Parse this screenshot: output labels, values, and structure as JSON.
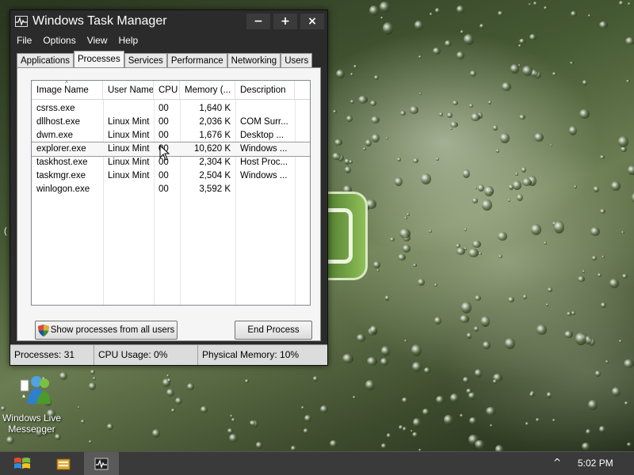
{
  "window": {
    "title": "Windows Task Manager",
    "controls": {
      "minimize": "−",
      "maximize": "+",
      "close": "×"
    }
  },
  "menu": [
    "File",
    "Options",
    "View",
    "Help"
  ],
  "tabs": [
    "Applications",
    "Processes",
    "Services",
    "Performance",
    "Networking",
    "Users"
  ],
  "active_tab": "Processes",
  "columns": [
    "Image Name",
    "User Name",
    "CPU",
    "Memory (...",
    "Description"
  ],
  "processes": [
    {
      "image": "csrss.exe",
      "user": "",
      "cpu": "00",
      "memory": "1,640 K",
      "desc": ""
    },
    {
      "image": "dllhost.exe",
      "user": "Linux Mint",
      "cpu": "00",
      "memory": "2,036 K",
      "desc": "COM Surr..."
    },
    {
      "image": "dwm.exe",
      "user": "Linux Mint",
      "cpu": "00",
      "memory": "1,676 K",
      "desc": "Desktop ..."
    },
    {
      "image": "explorer.exe",
      "user": "Linux Mint",
      "cpu": "00",
      "memory": "10,620 K",
      "desc": "Windows ..."
    },
    {
      "image": "taskhost.exe",
      "user": "Linux Mint",
      "cpu": "00",
      "memory": "2,304 K",
      "desc": "Host Proc..."
    },
    {
      "image": "taskmgr.exe",
      "user": "Linux Mint",
      "cpu": "00",
      "memory": "2,504 K",
      "desc": "Windows ..."
    },
    {
      "image": "winlogon.exe",
      "user": "",
      "cpu": "00",
      "memory": "3,592 K",
      "desc": ""
    }
  ],
  "buttons": {
    "show_all": "Show processes from all users",
    "end_process": "End Process"
  },
  "status": {
    "processes": "Processes: 31",
    "cpu": "CPU Usage: 0%",
    "memory": "Physical Memory: 10%"
  },
  "desktop": {
    "icon_label": "Windows Live Messenger",
    "edge_char": "("
  },
  "taskbar": {
    "clock": "5:02 PM",
    "tray_arrow": "^"
  },
  "colors": {
    "titlebar": "#2b2b2b",
    "panel": "#f5f5f5",
    "taskbar": "#3a3a3a"
  }
}
